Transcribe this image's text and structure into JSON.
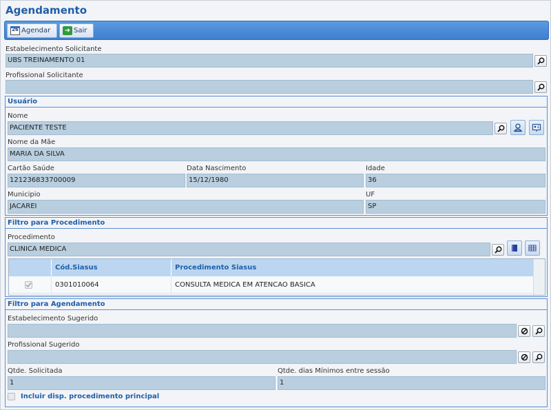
{
  "page": {
    "title": "Agendamento"
  },
  "toolbar": {
    "agendar_label": "Agendar",
    "sair_label": "Sair",
    "calendar_day": "26"
  },
  "solicitante": {
    "estabelecimento_label": "Estabelecimento Solicitante",
    "estabelecimento_value": "UBS TREINAMENTO 01",
    "profissional_label": "Profissional Solicitante",
    "profissional_value": ""
  },
  "usuario": {
    "section_title": "Usuário",
    "nome_label": "Nome",
    "nome_value": "PACIENTE TESTE",
    "mae_label": "Nome da Mãe",
    "mae_value": "MARIA DA SILVA",
    "cartao_label": "Cartão Saúde",
    "cartao_value": "121236833700009",
    "nascimento_label": "Data Nascimento",
    "nascimento_value": "15/12/1980",
    "idade_label": "Idade",
    "idade_value": "36",
    "municipio_label": "Municipio",
    "municipio_value": "JACAREI",
    "uf_label": "UF",
    "uf_value": "SP"
  },
  "filtro_procedimento": {
    "section_title": "Filtro para Procedimento",
    "procedimento_label": "Procedimento",
    "procedimento_value": "CLINICA MEDICA",
    "columns": [
      "Cód.Siasus",
      "Procedimento Siasus"
    ],
    "rows": [
      {
        "checked": true,
        "codigo": "0301010064",
        "procedimento": "CONSULTA MEDICA EM ATENCAO BASICA"
      }
    ]
  },
  "filtro_agendamento": {
    "section_title": "Filtro para Agendamento",
    "estabelecimento_label": "Estabelecimento Sugerido",
    "estabelecimento_value": "",
    "profissional_label": "Profissional Sugerido",
    "profissional_value": "",
    "qtde_label": "Qtde. Solicitada",
    "qtde_value": "1",
    "dias_label": "Qtde. dias Mínimos entre sessão",
    "dias_value": "1",
    "incluir_label": "Incluir disp. procedimento principal",
    "incluir_checked": false
  },
  "colors": {
    "accent": "#1f5ea8",
    "toolbar": "#4a8bd8",
    "field_bg": "#b9cfdf",
    "grid_header": "#bcd6f1"
  }
}
